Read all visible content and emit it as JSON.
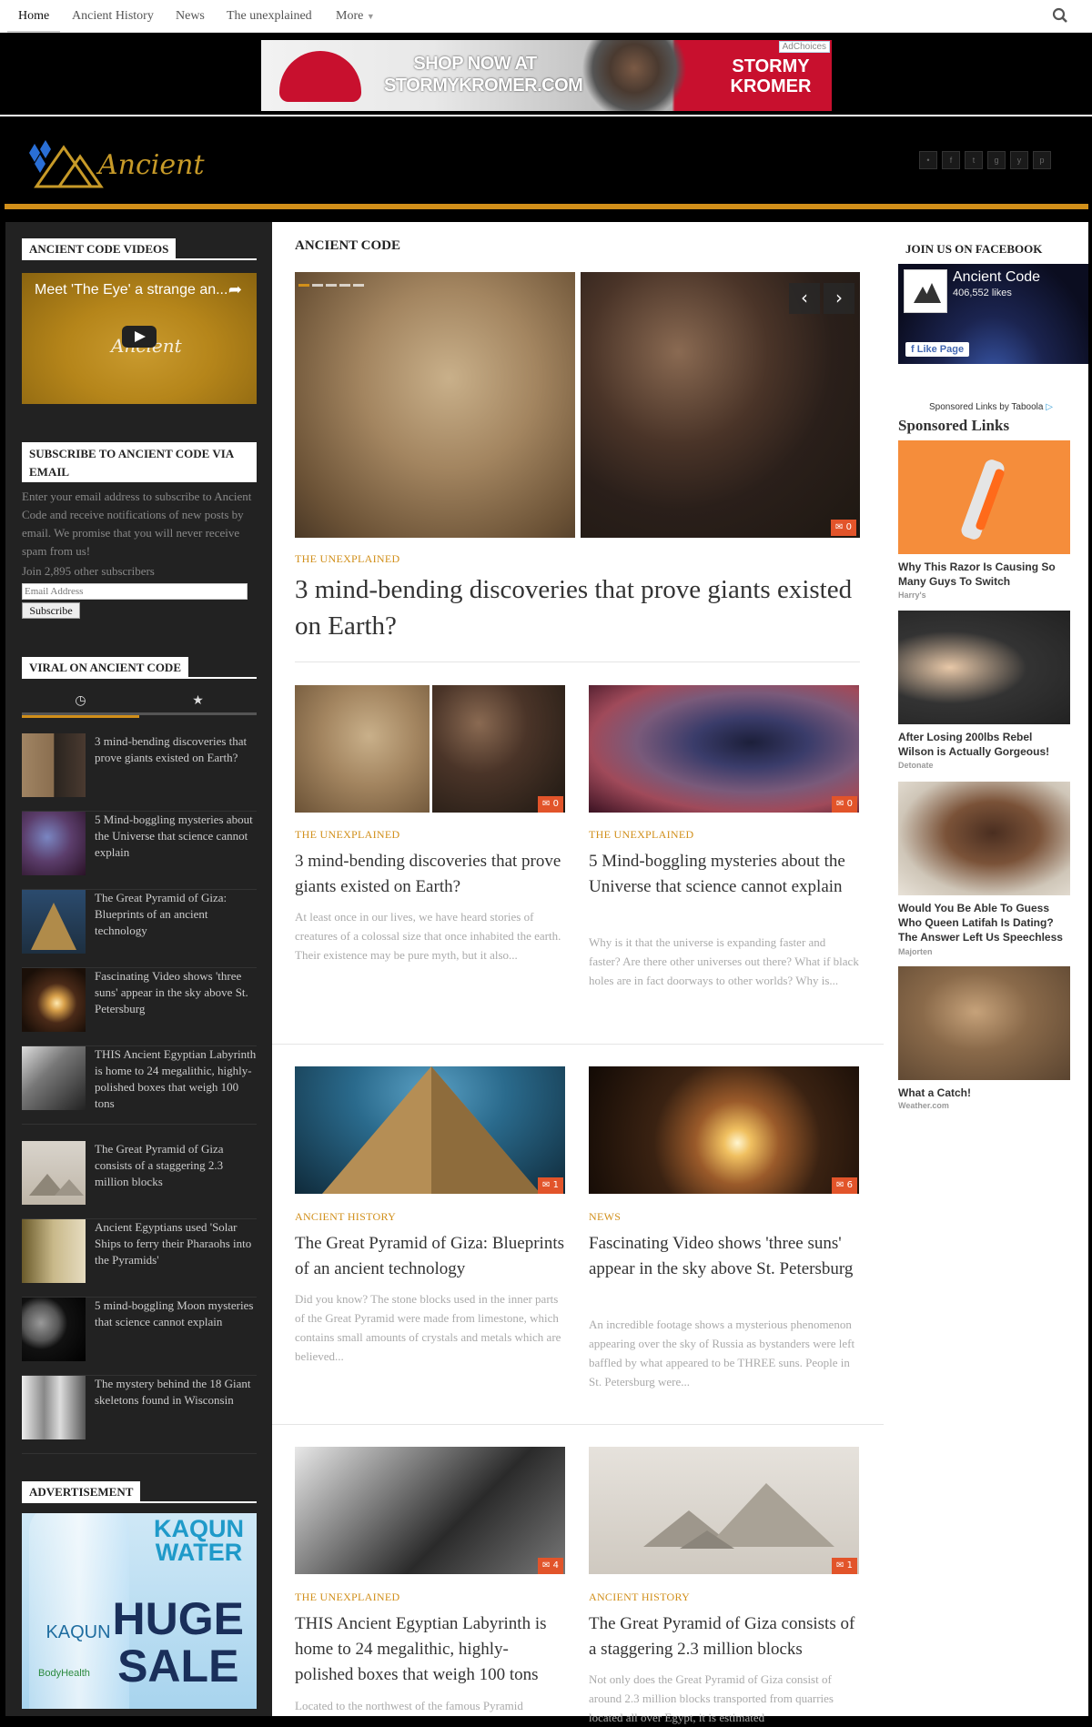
{
  "nav": {
    "items": [
      "Home",
      "Ancient History",
      "News",
      "The unexplained",
      "More"
    ]
  },
  "ad_banner": {
    "shop_line1": "SHOP NOW AT",
    "shop_line2": "STORMYKROMER.COM",
    "brand_line1": "STORMY",
    "brand_line2": "KROMER",
    "adchoices": "AdChoices"
  },
  "logo": {
    "text": "Ancient"
  },
  "sidebar": {
    "videos": {
      "title": "ANCIENT CODE VIDEOS",
      "video_title": "Meet 'The Eye' a strange an...",
      "video_logo": "Ancient"
    },
    "subscribe": {
      "title_line1": "SUBSCRIBE TO ANCIENT CODE VIA",
      "title_line2": "EMAIL",
      "text": "Enter your email address to subscribe to Ancient Code and receive notifications of new posts by email. We promise that you will never receive spam from us!",
      "subscribers": "Join 2,895 other subscribers",
      "email_placeholder": "Email Address",
      "button": "Subscribe"
    },
    "viral": {
      "title": "VIRAL ON ANCIENT CODE",
      "items": [
        "3 mind-bending discoveries that prove giants existed on Earth?",
        "5 Mind-boggling mysteries about the Universe that science cannot explain",
        "The Great Pyramid of Giza: Blueprints of an ancient technology",
        "Fascinating Video shows 'three suns' appear in the sky above St. Petersburg",
        "THIS Ancient Egyptian Labyrinth is home to 24 megalithic, highly-polished boxes that weigh 100 tons",
        "The Great Pyramid of Giza consists of a staggering 2.3 million blocks",
        "Ancient Egyptians used 'Solar Ships to ferry their Pharaohs into the Pyramids'",
        "5 mind-boggling Moon mysteries that science cannot explain",
        "The mystery behind the 18 Giant skeletons found in Wisconsin"
      ]
    },
    "advertisement": {
      "title": "ADVERTISEMENT",
      "line1": "KAQUN",
      "line2": "WATER",
      "line3": "HUGE",
      "line4": "SALE",
      "bottle_label": "KAQUN",
      "bottle_sub": "BodyHealth"
    }
  },
  "main": {
    "section": "ANCIENT CODE",
    "featured": {
      "category": "THE UNEXPLAINED",
      "title": "3 mind-bending discoveries that prove giants existed on Earth?",
      "comments": "0"
    },
    "cards": [
      {
        "category": "THE UNEXPLAINED",
        "title": "3 mind-bending discoveries that prove giants existed on Earth?",
        "excerpt": "At least once in our lives, we have heard stories of creatures of a colossal size that once inhabited the earth. Their existence may be pure myth, but it also...",
        "comments": "0"
      },
      {
        "category": "THE UNEXPLAINED",
        "title": "5 Mind-boggling mysteries about the Universe that science cannot explain",
        "excerpt": "Why is it that the universe is expanding faster and faster? Are there other universes out there? What if black holes are in fact doorways to other worlds? Why is...",
        "comments": "0"
      },
      {
        "category": "ANCIENT HISTORY",
        "title": "The Great Pyramid of Giza: Blueprints of an ancient technology",
        "excerpt": "Did you know? The stone blocks used in the inner parts of the Great Pyramid were made from limestone, which contains small amounts of crystals and metals which are believed...",
        "comments": "1"
      },
      {
        "category": "NEWS",
        "title": "Fascinating Video shows 'three suns' appear in the sky above St. Petersburg",
        "excerpt": "An incredible footage shows a mysterious phenomenon appearing over the sky of Russia as bystanders were left baffled by what appeared to be THREE suns. People in St. Petersburg were...",
        "comments": "6"
      },
      {
        "category": "THE UNEXPLAINED",
        "title": "THIS Ancient Egyptian Labyrinth is home to 24 megalithic, highly-polished boxes that weigh 100 tons",
        "excerpt": "Located to the northwest of the famous Pyramid",
        "comments": "4"
      },
      {
        "category": "ANCIENT HISTORY",
        "title": "The Great Pyramid of Giza consists of a staggering 2.3 million blocks",
        "excerpt": "Not only does the Great Pyramid of Giza consist of around 2.3 million blocks transported from quarries located all over Egypt, it is estimated",
        "comments": "1"
      }
    ]
  },
  "right": {
    "facebook": {
      "title": "JOIN US ON FACEBOOK",
      "page_name": "Ancient Code",
      "likes": "406,552 likes",
      "like_button": "Like Page"
    },
    "taboola": "Sponsored Links by Taboola",
    "sponsored_title": "Sponsored Links",
    "sponsored": [
      {
        "title": "Why This Razor Is Causing So Many Guys To Switch",
        "source": "Harry's"
      },
      {
        "title": "After Losing 200lbs Rebel Wilson is Actually Gorgeous!",
        "source": "Detonate"
      },
      {
        "title": "Would You Be Able To Guess Who Queen Latifah Is Dating? The Answer Left Us Speechless",
        "source": "Majorten"
      },
      {
        "title": "What a Catch!",
        "source": "Weather.com"
      }
    ]
  }
}
